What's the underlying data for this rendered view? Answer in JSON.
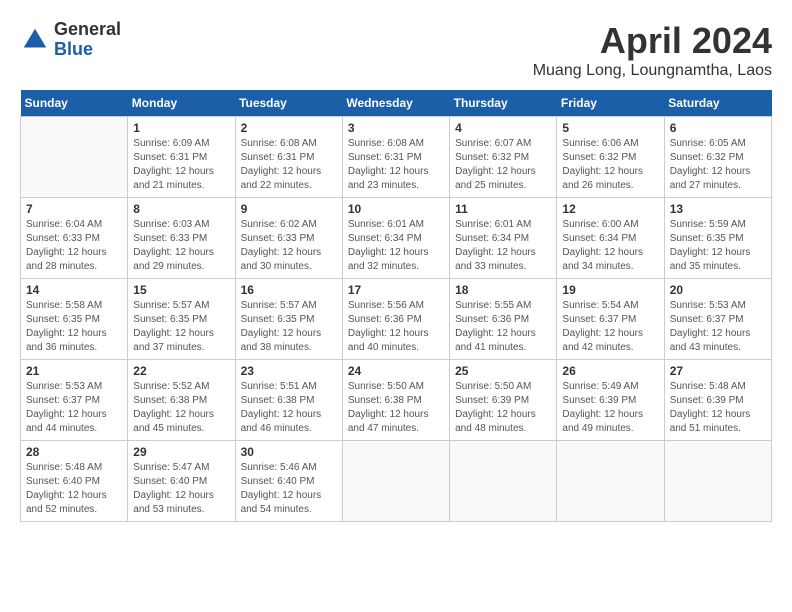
{
  "logo": {
    "general": "General",
    "blue": "Blue"
  },
  "title": "April 2024",
  "subtitle": "Muang Long, Loungnamtha, Laos",
  "days_of_week": [
    "Sunday",
    "Monday",
    "Tuesday",
    "Wednesday",
    "Thursday",
    "Friday",
    "Saturday"
  ],
  "weeks": [
    [
      {
        "day": "",
        "info": ""
      },
      {
        "day": "1",
        "info": "Sunrise: 6:09 AM\nSunset: 6:31 PM\nDaylight: 12 hours\nand 21 minutes."
      },
      {
        "day": "2",
        "info": "Sunrise: 6:08 AM\nSunset: 6:31 PM\nDaylight: 12 hours\nand 22 minutes."
      },
      {
        "day": "3",
        "info": "Sunrise: 6:08 AM\nSunset: 6:31 PM\nDaylight: 12 hours\nand 23 minutes."
      },
      {
        "day": "4",
        "info": "Sunrise: 6:07 AM\nSunset: 6:32 PM\nDaylight: 12 hours\nand 25 minutes."
      },
      {
        "day": "5",
        "info": "Sunrise: 6:06 AM\nSunset: 6:32 PM\nDaylight: 12 hours\nand 26 minutes."
      },
      {
        "day": "6",
        "info": "Sunrise: 6:05 AM\nSunset: 6:32 PM\nDaylight: 12 hours\nand 27 minutes."
      }
    ],
    [
      {
        "day": "7",
        "info": "Sunrise: 6:04 AM\nSunset: 6:33 PM\nDaylight: 12 hours\nand 28 minutes."
      },
      {
        "day": "8",
        "info": "Sunrise: 6:03 AM\nSunset: 6:33 PM\nDaylight: 12 hours\nand 29 minutes."
      },
      {
        "day": "9",
        "info": "Sunrise: 6:02 AM\nSunset: 6:33 PM\nDaylight: 12 hours\nand 30 minutes."
      },
      {
        "day": "10",
        "info": "Sunrise: 6:01 AM\nSunset: 6:34 PM\nDaylight: 12 hours\nand 32 minutes."
      },
      {
        "day": "11",
        "info": "Sunrise: 6:01 AM\nSunset: 6:34 PM\nDaylight: 12 hours\nand 33 minutes."
      },
      {
        "day": "12",
        "info": "Sunrise: 6:00 AM\nSunset: 6:34 PM\nDaylight: 12 hours\nand 34 minutes."
      },
      {
        "day": "13",
        "info": "Sunrise: 5:59 AM\nSunset: 6:35 PM\nDaylight: 12 hours\nand 35 minutes."
      }
    ],
    [
      {
        "day": "14",
        "info": "Sunrise: 5:58 AM\nSunset: 6:35 PM\nDaylight: 12 hours\nand 36 minutes."
      },
      {
        "day": "15",
        "info": "Sunrise: 5:57 AM\nSunset: 6:35 PM\nDaylight: 12 hours\nand 37 minutes."
      },
      {
        "day": "16",
        "info": "Sunrise: 5:57 AM\nSunset: 6:35 PM\nDaylight: 12 hours\nand 38 minutes."
      },
      {
        "day": "17",
        "info": "Sunrise: 5:56 AM\nSunset: 6:36 PM\nDaylight: 12 hours\nand 40 minutes."
      },
      {
        "day": "18",
        "info": "Sunrise: 5:55 AM\nSunset: 6:36 PM\nDaylight: 12 hours\nand 41 minutes."
      },
      {
        "day": "19",
        "info": "Sunrise: 5:54 AM\nSunset: 6:37 PM\nDaylight: 12 hours\nand 42 minutes."
      },
      {
        "day": "20",
        "info": "Sunrise: 5:53 AM\nSunset: 6:37 PM\nDaylight: 12 hours\nand 43 minutes."
      }
    ],
    [
      {
        "day": "21",
        "info": "Sunrise: 5:53 AM\nSunset: 6:37 PM\nDaylight: 12 hours\nand 44 minutes."
      },
      {
        "day": "22",
        "info": "Sunrise: 5:52 AM\nSunset: 6:38 PM\nDaylight: 12 hours\nand 45 minutes."
      },
      {
        "day": "23",
        "info": "Sunrise: 5:51 AM\nSunset: 6:38 PM\nDaylight: 12 hours\nand 46 minutes."
      },
      {
        "day": "24",
        "info": "Sunrise: 5:50 AM\nSunset: 6:38 PM\nDaylight: 12 hours\nand 47 minutes."
      },
      {
        "day": "25",
        "info": "Sunrise: 5:50 AM\nSunset: 6:39 PM\nDaylight: 12 hours\nand 48 minutes."
      },
      {
        "day": "26",
        "info": "Sunrise: 5:49 AM\nSunset: 6:39 PM\nDaylight: 12 hours\nand 49 minutes."
      },
      {
        "day": "27",
        "info": "Sunrise: 5:48 AM\nSunset: 6:39 PM\nDaylight: 12 hours\nand 51 minutes."
      }
    ],
    [
      {
        "day": "28",
        "info": "Sunrise: 5:48 AM\nSunset: 6:40 PM\nDaylight: 12 hours\nand 52 minutes."
      },
      {
        "day": "29",
        "info": "Sunrise: 5:47 AM\nSunset: 6:40 PM\nDaylight: 12 hours\nand 53 minutes."
      },
      {
        "day": "30",
        "info": "Sunrise: 5:46 AM\nSunset: 6:40 PM\nDaylight: 12 hours\nand 54 minutes."
      },
      {
        "day": "",
        "info": ""
      },
      {
        "day": "",
        "info": ""
      },
      {
        "day": "",
        "info": ""
      },
      {
        "day": "",
        "info": ""
      }
    ]
  ]
}
